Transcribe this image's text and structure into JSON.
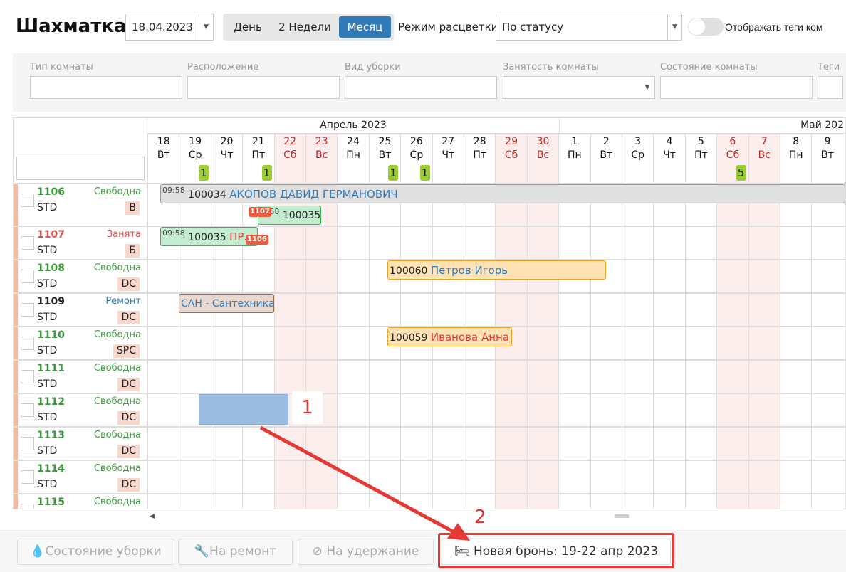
{
  "header": {
    "title": "Шахматка",
    "date": "18.04.2023",
    "views": [
      "День",
      "2 Недели",
      "Месяц"
    ],
    "active_view": "Месяц",
    "color_mode_label": "Режим расцветки",
    "color_mode": "По статусу",
    "toggle_label": "Отображать теги ком"
  },
  "filters": [
    "Тип комнаты",
    "Расположение",
    "Вид уборки",
    "Занятость комнаты",
    "Состояние комнаты",
    "Теги"
  ],
  "months": [
    "Апрель 2023",
    "Май 202"
  ],
  "days": [
    {
      "d": "18",
      "w": "Вт"
    },
    {
      "d": "19",
      "w": "Ср",
      "b": "1"
    },
    {
      "d": "20",
      "w": "Чт"
    },
    {
      "d": "21",
      "w": "Пт",
      "b": "1"
    },
    {
      "d": "22",
      "w": "Сб",
      "we": true
    },
    {
      "d": "23",
      "w": "Вс",
      "we": true
    },
    {
      "d": "24",
      "w": "Пн"
    },
    {
      "d": "25",
      "w": "Вт",
      "b": "1"
    },
    {
      "d": "26",
      "w": "Ср",
      "b": "1"
    },
    {
      "d": "27",
      "w": "Чт"
    },
    {
      "d": "28",
      "w": "Пт"
    },
    {
      "d": "29",
      "w": "Сб",
      "we": true
    },
    {
      "d": "30",
      "w": "Вс",
      "we": true
    },
    {
      "d": "1",
      "w": "Пн"
    },
    {
      "d": "2",
      "w": "Вт"
    },
    {
      "d": "3",
      "w": "Ср"
    },
    {
      "d": "4",
      "w": "Чт"
    },
    {
      "d": "5",
      "w": "Пт"
    },
    {
      "d": "6",
      "w": "Сб",
      "we": true,
      "b": "5"
    },
    {
      "d": "7",
      "w": "Вс",
      "we": true
    },
    {
      "d": "8",
      "w": "Пн"
    },
    {
      "d": "9",
      "w": "Вт"
    }
  ],
  "rooms": [
    {
      "num": "1106",
      "type": "STD",
      "status": "Свободна",
      "tag": "В",
      "color": "#3a9a3a"
    },
    {
      "num": "1107",
      "type": "STD",
      "status": "Занята",
      "tag": "Б",
      "color": "#d9534f"
    },
    {
      "num": "1108",
      "type": "STD",
      "status": "Свободна",
      "tag": "DC",
      "color": "#3a9a3a"
    },
    {
      "num": "1109",
      "type": "STD",
      "status": "Ремонт",
      "tag": "DC",
      "color": "#222",
      "scolor": "#337ab7"
    },
    {
      "num": "1110",
      "type": "STD",
      "status": "Свободна",
      "tag": "SPC",
      "color": "#3a9a3a"
    },
    {
      "num": "1111",
      "type": "STD",
      "status": "Свободна",
      "tag": "DC",
      "color": "#3a9a3a"
    },
    {
      "num": "1112",
      "type": "STD",
      "status": "Свободна",
      "tag": "DC",
      "color": "#3a9a3a"
    },
    {
      "num": "1113",
      "type": "STD",
      "status": "Свободна",
      "tag": "DC",
      "color": "#3a9a3a"
    },
    {
      "num": "1114",
      "type": "STD",
      "status": "Свободна",
      "tag": "DC",
      "color": "#3a9a3a"
    },
    {
      "num": "1115",
      "type": "STD",
      "status": "Свободна",
      "tag": "",
      "color": "#3a9a3a"
    }
  ],
  "bookings": {
    "b1": {
      "time": "09:58",
      "id": "100034",
      "name": "АКОПОВ ДАВИД ГЕРМАНОВИЧ"
    },
    "b2": {
      "time": "58",
      "id": "100035",
      "badge": "1107"
    },
    "b3": {
      "time": "09:58",
      "id": "100035",
      "name": "ПР...",
      "badge": "1106"
    },
    "b4": {
      "id": "100060",
      "name": "Петров Игорь"
    },
    "b5": {
      "name": "САН - Сантехника"
    },
    "b6": {
      "id": "100059",
      "name": "Иванова Анна"
    }
  },
  "annotations": {
    "one": "1",
    "two": "2"
  },
  "footer": {
    "cleaning": "Состояние уборки",
    "repair": "На ремонт",
    "hold": "На удержание",
    "new_booking": "Новая бронь: 19-22 апр 2023"
  }
}
